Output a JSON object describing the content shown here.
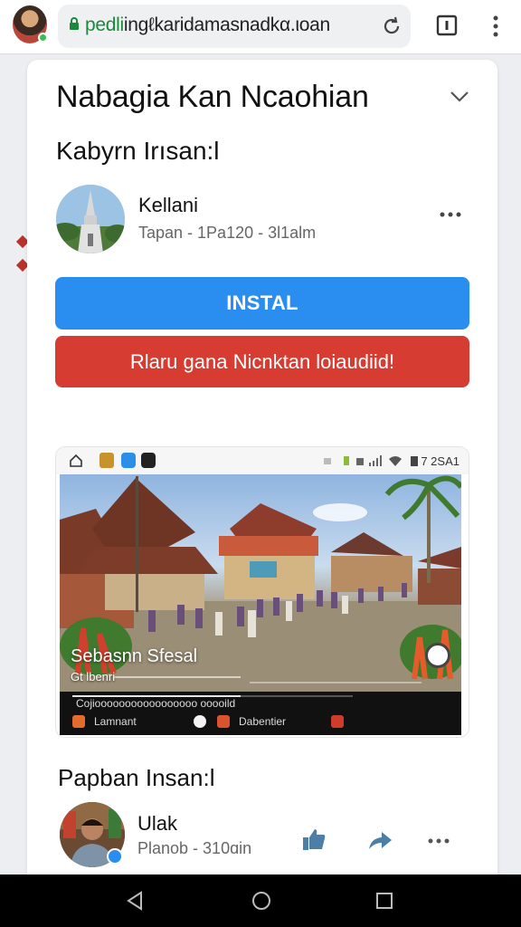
{
  "browser": {
    "url_prefix": "pedli",
    "url_rest": "ingℓkaridamasnadkα.ιoan",
    "tab_count_icon": "tabs-icon",
    "reload_icon": "reload-icon",
    "menu_icon": "vertical-dots-icon",
    "lock_icon": "lock-icon",
    "colors": {
      "lock": "#1a8a3a"
    }
  },
  "page": {
    "title": "Nabagia Kan Ncaohian",
    "section1_title": "Kabyrn Irısan:l",
    "collapse_icon": "chevron-down-icon"
  },
  "app": {
    "name": "Kellani",
    "meta": "Tapan - 1Pa120 - 3l1alm",
    "icon": "temple-tower-image"
  },
  "buttons": {
    "install": "INSTAL",
    "warning": "Rlaru gana Nicnktan loiaudiid!",
    "colors": {
      "install": "#2a8ef0",
      "warning": "#d63c31"
    }
  },
  "screenshot": {
    "status_time": "7 2SA1",
    "caption": "Sebasnn Sfesal",
    "sub_caption": "Gt lbenri",
    "bar_text": "Cojiooooooooooooooooo ooooild",
    "progress": 0.6,
    "bar_item_1": "Lamnant",
    "bar_item_2": "Dabentier"
  },
  "section2": {
    "title": "Papban Insan:l",
    "user_name": "Ulak",
    "user_meta": "Planob - 310ɑin",
    "like_icon": "thumbs-up-icon",
    "share_icon": "share-arrow-icon",
    "more_icon": "more-horizontal-icon"
  },
  "nav": {
    "back_icon": "back-triangle-icon",
    "home_icon": "home-circle-icon",
    "recents_icon": "recents-square-icon"
  }
}
